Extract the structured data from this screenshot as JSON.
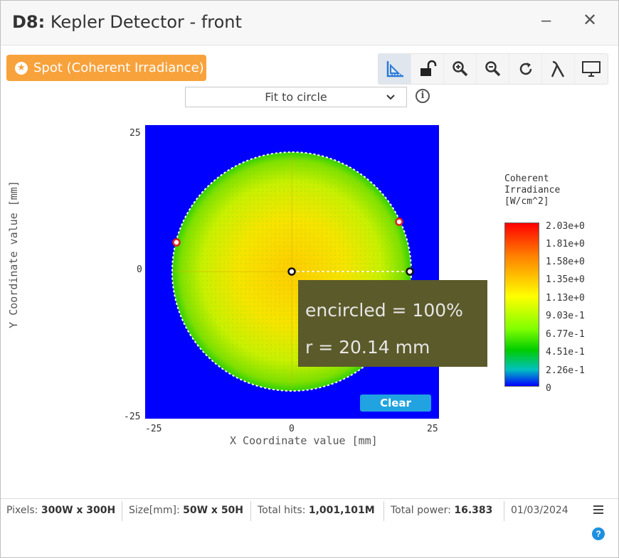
{
  "window": {
    "title_prefix": "D8:",
    "title_text": "Kepler Detector - front",
    "minimize_glyph": "–",
    "close_glyph": "✕"
  },
  "mode_button": {
    "label": "Spot (Coherent Irradiance)",
    "color": "#f8a23c"
  },
  "toolbar": {
    "tools": [
      "ruler-axes-icon",
      "unlock-icon",
      "zoom-in-icon",
      "zoom-out-icon",
      "refresh-icon",
      "lambda-icon",
      "monitor-icon"
    ]
  },
  "fit_select": {
    "value": "Fit to circle"
  },
  "plot": {
    "xlabel": "X Coordinate value [mm]",
    "ylabel": "Y Coordinate value [mm]",
    "x_ticks": [
      "-25",
      "0",
      "25"
    ],
    "y_ticks": [
      "25",
      "0",
      "-25"
    ],
    "xlim": [
      -25,
      25
    ],
    "ylim": [
      -25,
      25
    ],
    "background_color": "#0000ff",
    "spot_radius_mm": 20.14
  },
  "overlay": {
    "line1": "encircled = 100%",
    "line2": "r = 20.14 mm"
  },
  "clear_button": {
    "label": "Clear"
  },
  "legend": {
    "title": "Coherent\nIrradiance\n[W/cm^2]",
    "labels": [
      "2.03e+0",
      "1.81e+0",
      "1.58e+0",
      "1.35e+0",
      "1.13e+0",
      "9.03e-1",
      "6.77e-1",
      "4.51e-1",
      "2.26e-1",
      "0"
    ]
  },
  "status": {
    "pixels_label": "Pixels:",
    "pixels_value": "300W x 300H",
    "size_label": "Size[mm]:",
    "size_value": "50W x 50H",
    "hits_label": "Total hits:",
    "hits_value": "1,001,101M",
    "power_label": "Total power:",
    "power_value": "16.383",
    "date": "01/03/2024"
  },
  "help_glyph": "?"
}
